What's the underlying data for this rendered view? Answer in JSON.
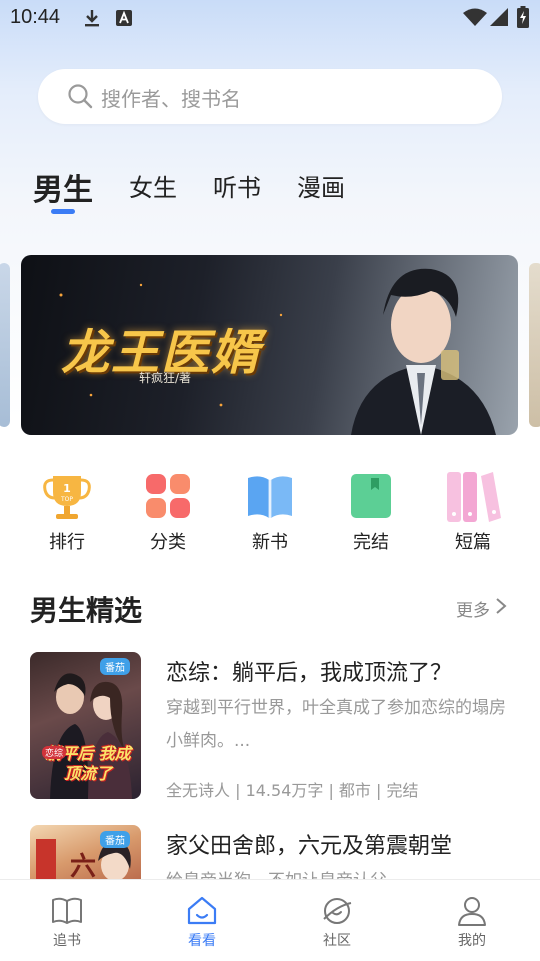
{
  "status_bar": {
    "time": "10:44"
  },
  "search": {
    "placeholder": "搜作者、搜书名"
  },
  "tabs": [
    {
      "label": "男生",
      "active": true
    },
    {
      "label": "女生",
      "active": false
    },
    {
      "label": "听书",
      "active": false
    },
    {
      "label": "漫画",
      "active": false
    }
  ],
  "banner": {
    "title": "龙王医婿",
    "author": "轩疯狂/著"
  },
  "categories": [
    {
      "label": "排行",
      "icon": "trophy-icon"
    },
    {
      "label": "分类",
      "icon": "grid-icon"
    },
    {
      "label": "新书",
      "icon": "open-book-icon"
    },
    {
      "label": "完结",
      "icon": "bookmark-book-icon"
    },
    {
      "label": "短篇",
      "icon": "binders-icon"
    }
  ],
  "section": {
    "title": "男生精选",
    "more": "更多"
  },
  "books": [
    {
      "title": "恋综：躺平后，我成顶流了？",
      "desc": "穿越到平行世界，叶全真成了参加恋综的塌房小鲜肉。...",
      "meta": "全无诗人 | 14.54万字 | 都市 | 完结",
      "cover_text": "躺平后 我成顶流了",
      "cover_badge": "恋综",
      "cover_logo": "番茄"
    },
    {
      "title": "家父田舍郎，六元及第震朝堂",
      "desc": "给皇帝当狗，不如让皇帝认父。",
      "cover_logo": "番茄"
    }
  ],
  "bottom_nav": [
    {
      "label": "追书",
      "icon": "book-icon",
      "active": false
    },
    {
      "label": "看看",
      "icon": "home-icon",
      "active": true
    },
    {
      "label": "社区",
      "icon": "planet-icon",
      "active": false
    },
    {
      "label": "我的",
      "icon": "person-icon",
      "active": false
    }
  ],
  "colors": {
    "accent": "#3b7cf5",
    "banner_title": "#f7c64a"
  }
}
